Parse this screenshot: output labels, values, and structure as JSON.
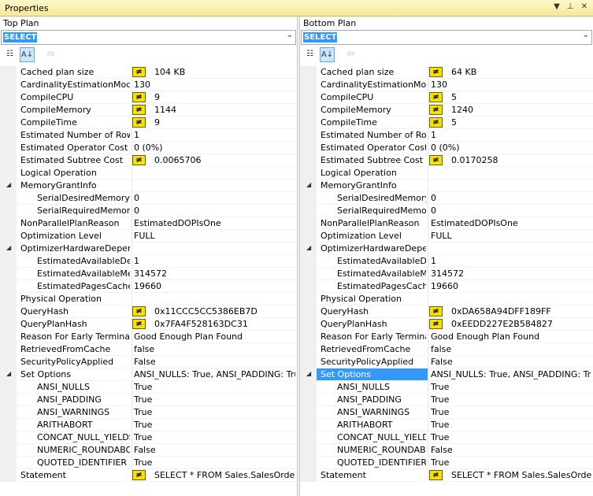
{
  "window": {
    "title": "Properties",
    "dropdown_glyph": "▼",
    "pin_glyph": "⊥",
    "close_glyph": "✕"
  },
  "panes": [
    {
      "label": "Top Plan",
      "selector": "SELECT",
      "rows": [
        {
          "name": "Cached plan size",
          "value": "104 KB",
          "icon": true
        },
        {
          "name": "CardinalityEstimationModelVe",
          "value": "130"
        },
        {
          "name": "CompileCPU",
          "value": "9",
          "icon": true
        },
        {
          "name": "CompileMemory",
          "value": "1144",
          "icon": true
        },
        {
          "name": "CompileTime",
          "value": "9",
          "icon": true
        },
        {
          "name": "Estimated Number of Rows",
          "value": "1"
        },
        {
          "name": "Estimated Operator Cost",
          "value": "0 (0%)"
        },
        {
          "name": "Estimated Subtree Cost",
          "value": "0.0065706",
          "icon": true
        },
        {
          "name": "Logical Operation",
          "value": ""
        },
        {
          "name": "MemoryGrantInfo",
          "value": "",
          "expand": true
        },
        {
          "name": "SerialDesiredMemory",
          "value": "0",
          "indent": true
        },
        {
          "name": "SerialRequiredMemory",
          "value": "0",
          "indent": true
        },
        {
          "name": "NonParallelPlanReason",
          "value": "EstimatedDOPIsOne"
        },
        {
          "name": "Optimization Level",
          "value": "FULL"
        },
        {
          "name": "OptimizerHardwareDependen",
          "value": "",
          "expand": true
        },
        {
          "name": "EstimatedAvailableDegre",
          "value": "1",
          "indent": true
        },
        {
          "name": "EstimatedAvailableMemo",
          "value": "314572",
          "indent": true
        },
        {
          "name": "EstimatedPagesCached",
          "value": "19660",
          "indent": true
        },
        {
          "name": "Physical Operation",
          "value": ""
        },
        {
          "name": "QueryHash",
          "value": "0x11CCC5CC5386EB7D",
          "icon": true
        },
        {
          "name": "QueryPlanHash",
          "value": "0x7FA4F528163DC31",
          "icon": true
        },
        {
          "name": "Reason For Early Termination",
          "value": "Good Enough Plan Found"
        },
        {
          "name": "RetrievedFromCache",
          "value": "false"
        },
        {
          "name": "SecurityPolicyApplied",
          "value": "False"
        },
        {
          "name": "Set Options",
          "value": "ANSI_NULLS: True, ANSI_PADDING: True",
          "expand": true
        },
        {
          "name": "ANSI_NULLS",
          "value": "True",
          "indent": true
        },
        {
          "name": "ANSI_PADDING",
          "value": "True",
          "indent": true
        },
        {
          "name": "ANSI_WARNINGS",
          "value": "True",
          "indent": true
        },
        {
          "name": "ARITHABORT",
          "value": "True",
          "indent": true
        },
        {
          "name": "CONCAT_NULL_YIELDS",
          "value": "True",
          "indent": true
        },
        {
          "name": "NUMERIC_ROUNDABO",
          "value": "False",
          "indent": true
        },
        {
          "name": "QUOTED_IDENTIFIER",
          "value": "True",
          "indent": true
        },
        {
          "name": "Statement",
          "value": "SELECT * FROM Sales.SalesOrderDe",
          "icon": true
        }
      ]
    },
    {
      "label": "Bottom Plan",
      "selector": "SELECT",
      "rows": [
        {
          "name": "Cached plan size",
          "value": "64 KB",
          "icon": true
        },
        {
          "name": "CardinalityEstimationModelVe",
          "value": "130"
        },
        {
          "name": "CompileCPU",
          "value": "5",
          "icon": true
        },
        {
          "name": "CompileMemory",
          "value": "1240",
          "icon": true
        },
        {
          "name": "CompileTime",
          "value": "5",
          "icon": true
        },
        {
          "name": "Estimated Number of Rows",
          "value": "1"
        },
        {
          "name": "Estimated Operator Cost",
          "value": "0 (0%)"
        },
        {
          "name": "Estimated Subtree Cost",
          "value": "0.0170258",
          "icon": true
        },
        {
          "name": "Logical Operation",
          "value": ""
        },
        {
          "name": "MemoryGrantInfo",
          "value": "",
          "expand": true
        },
        {
          "name": "SerialDesiredMemory",
          "value": "0",
          "indent": true
        },
        {
          "name": "SerialRequiredMemory",
          "value": "0",
          "indent": true
        },
        {
          "name": "NonParallelPlanReason",
          "value": "EstimatedDOPIsOne"
        },
        {
          "name": "Optimization Level",
          "value": "FULL"
        },
        {
          "name": "OptimizerHardwareDepender",
          "value": "",
          "expand": true
        },
        {
          "name": "EstimatedAvailableDegre",
          "value": "1",
          "indent": true
        },
        {
          "name": "EstimatedAvailableMemo",
          "value": "314572",
          "indent": true
        },
        {
          "name": "EstimatedPagesCached",
          "value": "19660",
          "indent": true
        },
        {
          "name": "Physical Operation",
          "value": ""
        },
        {
          "name": "QueryHash",
          "value": "0xDA658A94DFF189FF",
          "icon": true
        },
        {
          "name": "QueryPlanHash",
          "value": "0xEEDD227E2B584827",
          "icon": true
        },
        {
          "name": "Reason For Early Terminatio",
          "value": "Good Enough Plan Found"
        },
        {
          "name": "RetrievedFromCache",
          "value": "false"
        },
        {
          "name": "SecurityPolicyApplied",
          "value": "False"
        },
        {
          "name": "Set Options",
          "value": "ANSI_NULLS: True, ANSI_PADDING: True",
          "expand": true,
          "selected": true
        },
        {
          "name": "ANSI_NULLS",
          "value": "True",
          "indent": true
        },
        {
          "name": "ANSI_PADDING",
          "value": "True",
          "indent": true
        },
        {
          "name": "ANSI_WARNINGS",
          "value": "True",
          "indent": true
        },
        {
          "name": "ARITHABORT",
          "value": "True",
          "indent": true
        },
        {
          "name": "CONCAT_NULL_YIELD",
          "value": "True",
          "indent": true
        },
        {
          "name": "NUMERIC_ROUNDABO",
          "value": "False",
          "indent": true
        },
        {
          "name": "QUOTED_IDENTIFIER",
          "value": "True",
          "indent": true
        },
        {
          "name": "Statement",
          "value": "SELECT * FROM Sales.SalesOrderDe",
          "icon": true
        }
      ]
    }
  ],
  "icons": {
    "diff": "≠",
    "expand": "◢",
    "categorized": "☷",
    "alpha": "A↓",
    "pages": "▭",
    "combo_arrow": "⌄"
  }
}
